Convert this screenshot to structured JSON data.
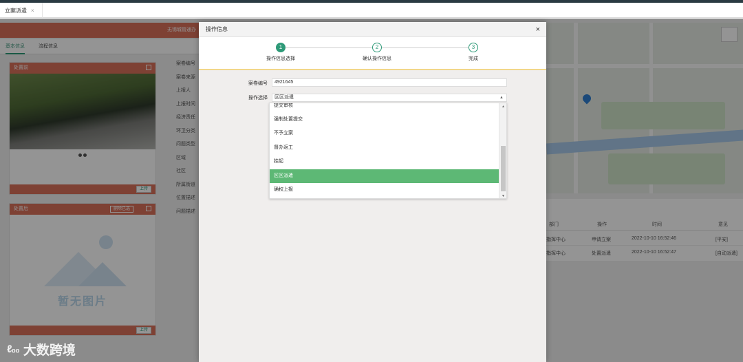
{
  "tabs": [
    {
      "label": "立案派遣",
      "close": "×"
    }
  ],
  "background": {
    "header_title": "无锡城管通办",
    "sub_tabs": [
      "基本信息",
      "流程信息"
    ],
    "panel_before": {
      "title": "处置前",
      "upload": "上传"
    },
    "panel_after": {
      "title": "处置后",
      "delete": "删除已选",
      "upload": "上传",
      "no_image": "暂无图片"
    },
    "form_labels": [
      "案卷编号",
      "案卷来源",
      "上报人",
      "上报时间",
      "经济责任",
      "环卫分类",
      "问题类型",
      "区域",
      "社区",
      "所属街道",
      "位置描述",
      "问题描述"
    ],
    "table": {
      "headers": [
        "部门",
        "操作",
        "时间",
        "意见"
      ],
      "rows": [
        [
          "指挥中心",
          "申请立案",
          "2022-10-10 16:52:46",
          "[平安]"
        ],
        [
          "指挥中心",
          "处置派遣",
          "2022-10-10 16:52:47",
          "[自动派遣]"
        ]
      ]
    }
  },
  "modal": {
    "title": "操作信息",
    "close": "×",
    "steps": [
      {
        "num": "1",
        "label": "操作信息选择"
      },
      {
        "num": "2",
        "label": "确认操作信息"
      },
      {
        "num": "3",
        "label": "完成"
      }
    ],
    "case_label": "案卷编号",
    "case_value": "4921645",
    "op_label": "操作选择",
    "op_value": "区区派遣",
    "options": [
      "提交审核",
      "强制处置提交",
      "不予立案",
      "督办返工",
      "挂起",
      "区区派遣",
      "确权上报"
    ],
    "selected_index": 5
  },
  "watermark": {
    "logo": "ℓ₀₀",
    "text": "大数跨境"
  },
  "colors": {
    "accent": "#2e9a78",
    "header": "#d9705a",
    "selected": "#5db875"
  }
}
